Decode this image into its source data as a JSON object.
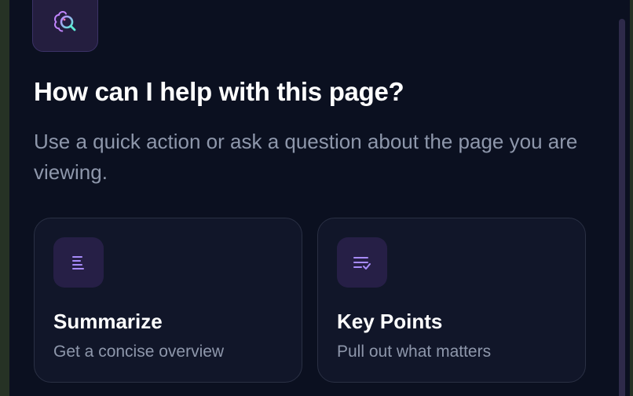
{
  "logo": {
    "icon": "brain-search-icon"
  },
  "heading": "How can I help with this page?",
  "subtext": "Use a quick action or ask a question about the page you are viewing.",
  "actions": [
    {
      "icon": "summary-lines-icon",
      "title": "Summarize",
      "description": "Get a concise overview"
    },
    {
      "icon": "checklist-icon",
      "title": "Key Points",
      "description": "Pull out what matters"
    }
  ],
  "colors": {
    "background": "#0b1020",
    "accent": "#a78bfa",
    "card": "#111629",
    "icon_tile": "#261f46",
    "text_muted": "#8e97ab"
  }
}
